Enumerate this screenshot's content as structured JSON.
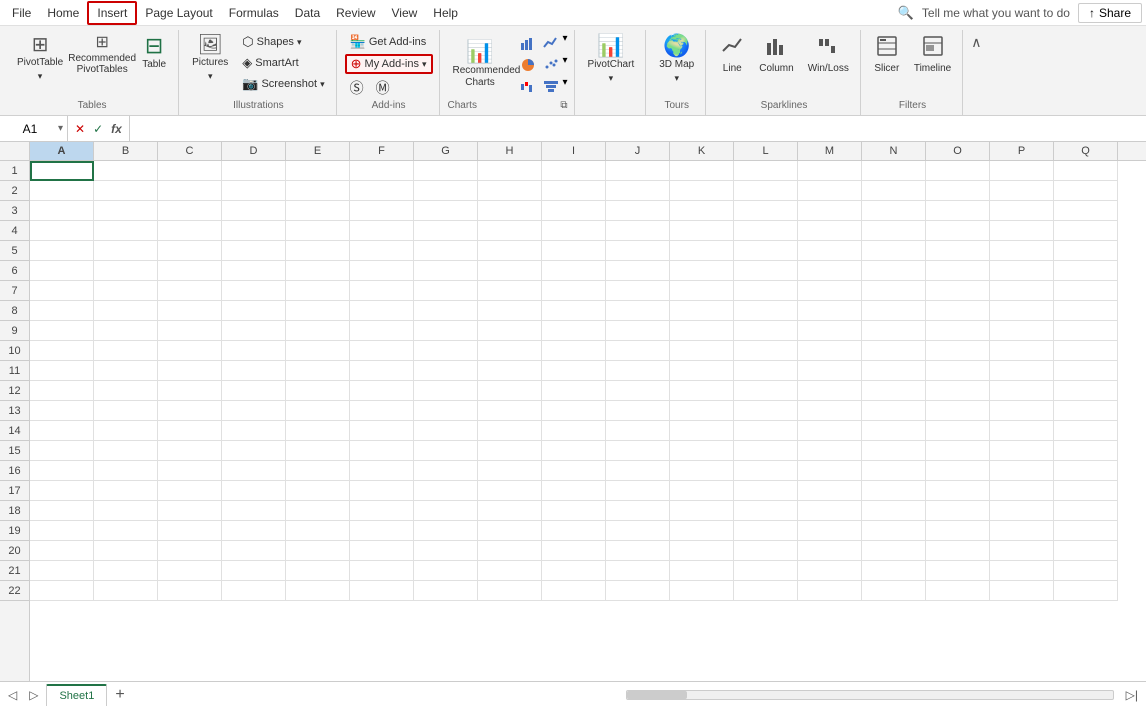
{
  "menubar": {
    "items": [
      "File",
      "Home",
      "Insert",
      "Page Layout",
      "Formulas",
      "Data",
      "Review",
      "View",
      "Help"
    ],
    "active": "Insert"
  },
  "search": {
    "placeholder": "Tell me what you want to do",
    "text": "Tell me what you want to do"
  },
  "share": {
    "label": "Share"
  },
  "ribbon": {
    "groups": [
      {
        "name": "Tables",
        "buttons": [
          {
            "id": "pivottable",
            "label": "PivotTable",
            "icon": "⊞"
          },
          {
            "id": "recommended-pivottables",
            "label": "Recommended PivotTables",
            "icon": "⊞"
          },
          {
            "id": "table",
            "label": "Table",
            "icon": "⊟"
          }
        ]
      },
      {
        "name": "Illustrations",
        "buttons": [
          {
            "id": "pictures",
            "label": "Pictures",
            "icon": "🖼"
          },
          {
            "id": "shapes",
            "label": "Shapes",
            "icon": "⬡",
            "dropdown": true
          },
          {
            "id": "smartart",
            "label": "SmartArt",
            "icon": "◈"
          },
          {
            "id": "screenshot",
            "label": "Screenshot",
            "icon": "📷",
            "dropdown": true
          }
        ]
      },
      {
        "name": "Add-ins",
        "buttons": [
          {
            "id": "get-addins",
            "label": "Get Add-ins",
            "icon": "🏪"
          },
          {
            "id": "my-addins",
            "label": "My Add-ins",
            "icon": "⊕",
            "highlighted": true,
            "dropdown": true
          },
          {
            "id": "office-store-1",
            "label": "",
            "icon": "Ⓢ"
          },
          {
            "id": "office-store-2",
            "label": "",
            "icon": "Ⓜ"
          }
        ]
      },
      {
        "name": "Charts",
        "buttons": [
          {
            "id": "recommended-charts",
            "label": "Recommended Charts",
            "icon": "📊"
          }
        ],
        "chart_icons": [
          "📈",
          "📊",
          "📉",
          "◙",
          "⬛",
          "◉"
        ]
      },
      {
        "name": "",
        "buttons": [
          {
            "id": "pivotchart",
            "label": "PivotChart",
            "icon": "📊",
            "dropdown": true
          }
        ]
      },
      {
        "name": "Tours",
        "buttons": [
          {
            "id": "3d-map",
            "label": "3D Map",
            "icon": "🌍",
            "dropdown": true
          }
        ]
      },
      {
        "name": "Sparklines",
        "buttons": [
          {
            "id": "line",
            "label": "Line",
            "icon": "📈"
          },
          {
            "id": "column-sparkline",
            "label": "Column",
            "icon": "📊"
          },
          {
            "id": "win-loss",
            "label": "Win/Loss",
            "icon": "⬛"
          }
        ]
      },
      {
        "name": "Filters",
        "buttons": [
          {
            "id": "slicer",
            "label": "Slicer",
            "icon": "🔲"
          },
          {
            "id": "timeline",
            "label": "Timeline",
            "icon": "⬜"
          }
        ]
      }
    ]
  },
  "formulabar": {
    "cellref": "A1",
    "formula": "",
    "fx": "fx"
  },
  "grid": {
    "columns": [
      "A",
      "B",
      "C",
      "D",
      "E",
      "F",
      "G",
      "H",
      "I",
      "J",
      "K",
      "L",
      "M",
      "N",
      "O",
      "P",
      "Q"
    ],
    "rows": 22,
    "active_cell": "A1"
  },
  "sheets": [
    {
      "name": "Sheet1",
      "active": true
    }
  ],
  "statusbar": {
    "add_sheet": "+"
  }
}
